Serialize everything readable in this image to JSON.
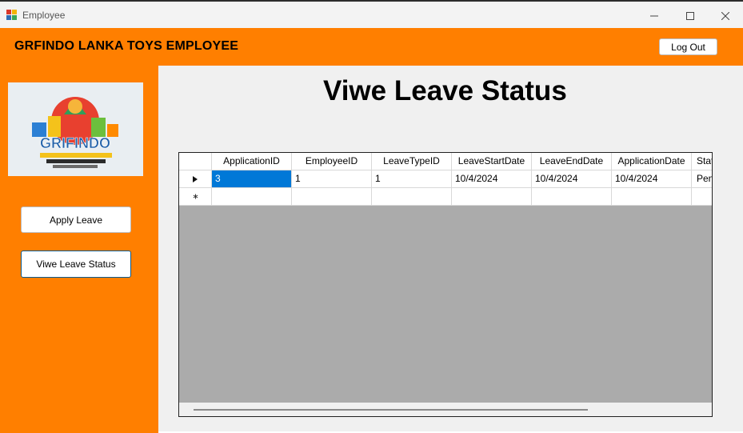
{
  "window": {
    "title": "Employee",
    "controls": [
      "minimize-icon",
      "maximize-icon",
      "close-icon"
    ]
  },
  "header": {
    "brand": "GRFINDO LANKA TOYS EMPLOYEE",
    "logout_label": "Log Out"
  },
  "colors": {
    "accent": "#ff7f00",
    "selection": "#0078d7",
    "grid_background": "#ababab"
  },
  "sidebar": {
    "logo_icon": "grifindo-logo-icon",
    "apply_leave_label": "Apply Leave",
    "view_status_label": "Viwe Leave Status"
  },
  "main": {
    "title": "Viwe Leave Status"
  },
  "grid": {
    "columns": [
      "ApplicationID",
      "EmployeeID",
      "LeaveTypeID",
      "LeaveStartDate",
      "LeaveEndDate",
      "ApplicationDate",
      "Stat"
    ],
    "rows": [
      [
        "3",
        "1",
        "1",
        "10/4/2024",
        "10/4/2024",
        "10/4/2024",
        "Pend"
      ]
    ],
    "selected_cell": {
      "row": 0,
      "column": 0
    },
    "current_row_indicator": "row-pointer-icon",
    "new_row_indicator": "new-row-asterisk-icon"
  }
}
